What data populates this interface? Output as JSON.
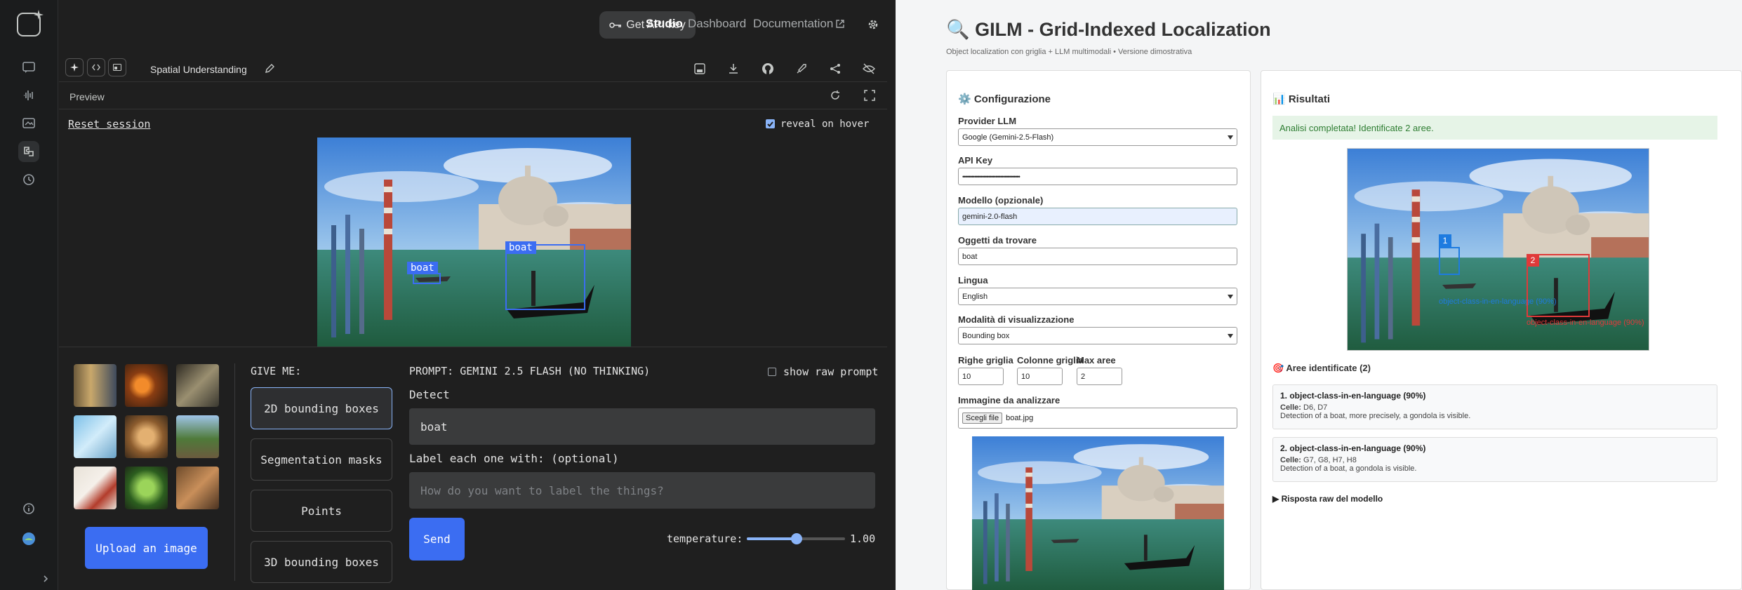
{
  "studio": {
    "topbar": {
      "api_key_label": "Get API key",
      "studio_label": "Studio",
      "dashboard_label": "Dashboard",
      "docs_label": "Documentation"
    },
    "toolbar": {
      "app_title": "Spatial Understanding"
    },
    "preview": {
      "label": "Preview",
      "reset_label": "Reset session",
      "reveal_label": "reveal on hover"
    },
    "detections": [
      {
        "label": "boat"
      },
      {
        "label": "boat"
      }
    ],
    "give_me": {
      "heading": "GIVE ME:",
      "options": [
        {
          "label": "2D bounding boxes"
        },
        {
          "label": "Segmentation masks"
        },
        {
          "label": "Points"
        },
        {
          "label": "3D bounding boxes"
        }
      ]
    },
    "prompt": {
      "heading": "PROMPT: GEMINI 2.5 FLASH (NO THINKING)",
      "raw_label": "show raw prompt",
      "detect_label": "Detect",
      "detect_value": "boat",
      "label_heading": "Label each one with: (optional)",
      "label_placeholder": "How do you want to label the things?",
      "send_label": "Send",
      "temperature_label": "temperature:",
      "temperature_value": "1.00"
    },
    "upload_label": "Upload an image"
  },
  "gilm": {
    "title": "🔍 GILM - Grid-Indexed Localization",
    "subtitle": "Object localization con griglia + LLM multimodali • Versione dimostrativa",
    "config": {
      "heading": "⚙️ Configurazione",
      "provider_label": "Provider LLM",
      "provider_value": "Google (Gemini-2.5-Flash)",
      "apikey_label": "API Key",
      "apikey_value": "••••••••••••••••••••••••••••••••••••••",
      "model_label": "Modello (opzionale)",
      "model_value": "gemini-2.0-flash",
      "objects_label": "Oggetti da trovare",
      "objects_value": "boat",
      "lang_label": "Lingua",
      "lang_value": "English",
      "mode_label": "Modalità di visualizzazione",
      "mode_value": "Bounding box",
      "rows_label": "Righe griglia",
      "rows_value": "10",
      "cols_label": "Colonne griglia",
      "cols_value": "10",
      "max_label": "Max aree",
      "max_value": "2",
      "image_label": "Immagine da analizzare",
      "choose_label": "Scegli file",
      "file_value": "boat.jpg"
    },
    "results": {
      "heading": "📊 Risultati",
      "success": "Analisi completata! Identificate 2 aree.",
      "marker1": "1",
      "marker2": "2",
      "overlay1": "object-class-in-en-language (90%)",
      "overlay2": "object-class-in-en-language (90%)",
      "areas_heading": "🎯 Aree identificate (2)",
      "cells_label": "Celle:",
      "areas": [
        {
          "title": "1. object-class-in-en-language (90%)",
          "cells": "D6, D7",
          "desc": "Detection of a boat, more precisely, a gondola is visible."
        },
        {
          "title": "2. object-class-in-en-language (90%)",
          "cells": "G7, G8, H7, H8",
          "desc": "Detection of a boat, a gondola is visible."
        }
      ],
      "raw_toggle": "▶ Risposta raw del modello"
    }
  },
  "colors": {
    "accent": "#3b6df2",
    "marker1": "#1e7be0",
    "marker2": "#e03a3a",
    "success_bg": "#e6f4e7",
    "success_fg": "#2e7d32"
  }
}
